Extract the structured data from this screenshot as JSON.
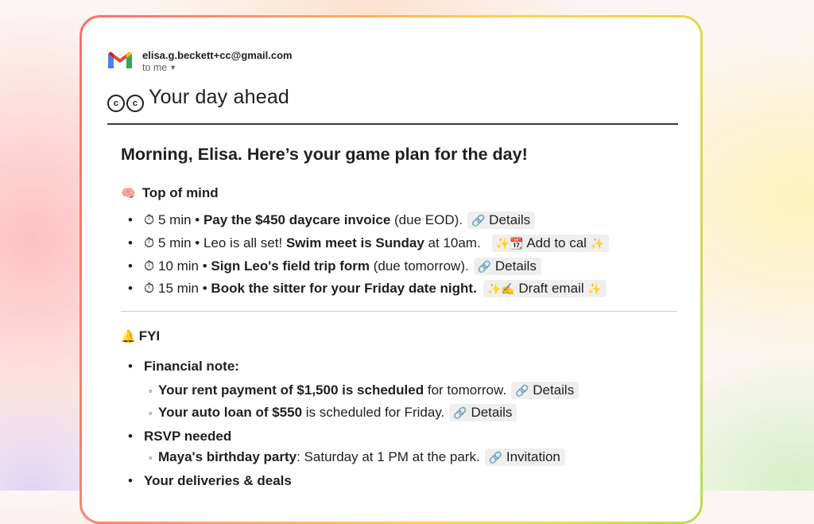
{
  "email": {
    "sender": "elisa.g.beckett+cc@gmail.com",
    "to_label": "to me",
    "subject_glyphs": [
      "c",
      "c"
    ],
    "subject": "Your day ahead"
  },
  "greeting": "Morning, Elisa. Here’s your game plan for the day!",
  "top_of_mind": {
    "emoji": "🧠",
    "title": "Top of mind",
    "items": [
      {
        "time": "⏱ 5 min •",
        "bold": "Pay the $450 daycare invoice",
        "rest": "(due EOD).",
        "chip_icon": "🔗",
        "chip_label": "Details",
        "chip_trail": ""
      },
      {
        "time": "⏱ 5 min •",
        "pre": "Leo is all set!",
        "bold": "Swim meet is Sunday",
        "rest": "at 10am.",
        "chip_icon": "✨📆",
        "chip_label": "Add to cal",
        "chip_trail": "✨"
      },
      {
        "time": "⏱ 10 min •",
        "bold": "Sign Leo's field trip form",
        "rest": "(due tomorrow).",
        "chip_icon": "🔗",
        "chip_label": "Details",
        "chip_trail": ""
      },
      {
        "time": "⏱ 15 min •",
        "bold": "Book the sitter for your Friday date night.",
        "rest": "",
        "chip_icon": "✨✍️",
        "chip_label": "Draft email",
        "chip_trail": "✨"
      }
    ]
  },
  "fyi": {
    "emoji": "🔔",
    "title": "FYI",
    "financial_label": "Financial note:",
    "rent": {
      "bold": "Your rent payment of $1,500 is scheduled",
      "rest": "for tomorrow.",
      "chip_icon": "🔗",
      "chip_label": "Details"
    },
    "loan": {
      "bold": "Your auto loan of $550",
      "rest": "is scheduled for Friday.",
      "chip_icon": "🔗",
      "chip_label": "Details"
    },
    "rsvp_label": "RSVP needed",
    "party": {
      "bold": "Maya's birthday party",
      "rest": ": Saturday at 1 PM at the park.",
      "chip_icon": "🔗",
      "chip_label": "Invitation"
    },
    "deliveries_label": "Your deliveries & deals"
  },
  "colors": {
    "gmail_red": "#ea4335",
    "gmail_blue": "#4285f4",
    "gmail_green": "#34a853",
    "gmail_yellow": "#fbbc04",
    "chip_bg": "#efefef"
  }
}
